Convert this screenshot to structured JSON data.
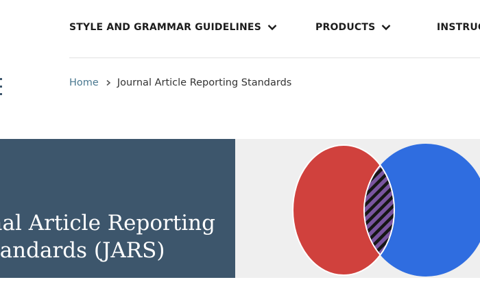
{
  "nav": {
    "items": [
      {
        "label": "STYLE AND GRAMMAR GUIDELINES"
      },
      {
        "label": "PRODUCTS"
      },
      {
        "label": "INSTRUCTIONAL AIDS"
      }
    ]
  },
  "breadcrumb": {
    "home": "Home",
    "current": "Journal Article Reporting Standards"
  },
  "hero": {
    "title_line1": "Journal Article Reporting",
    "title_line2": "Standards (JARS)"
  },
  "colors": {
    "hero_dark": "#3d566c",
    "venn_red": "#d0413d",
    "venn_blue": "#2f6de0",
    "venn_overlap": "#6f4a8f",
    "link": "#4a7890"
  }
}
